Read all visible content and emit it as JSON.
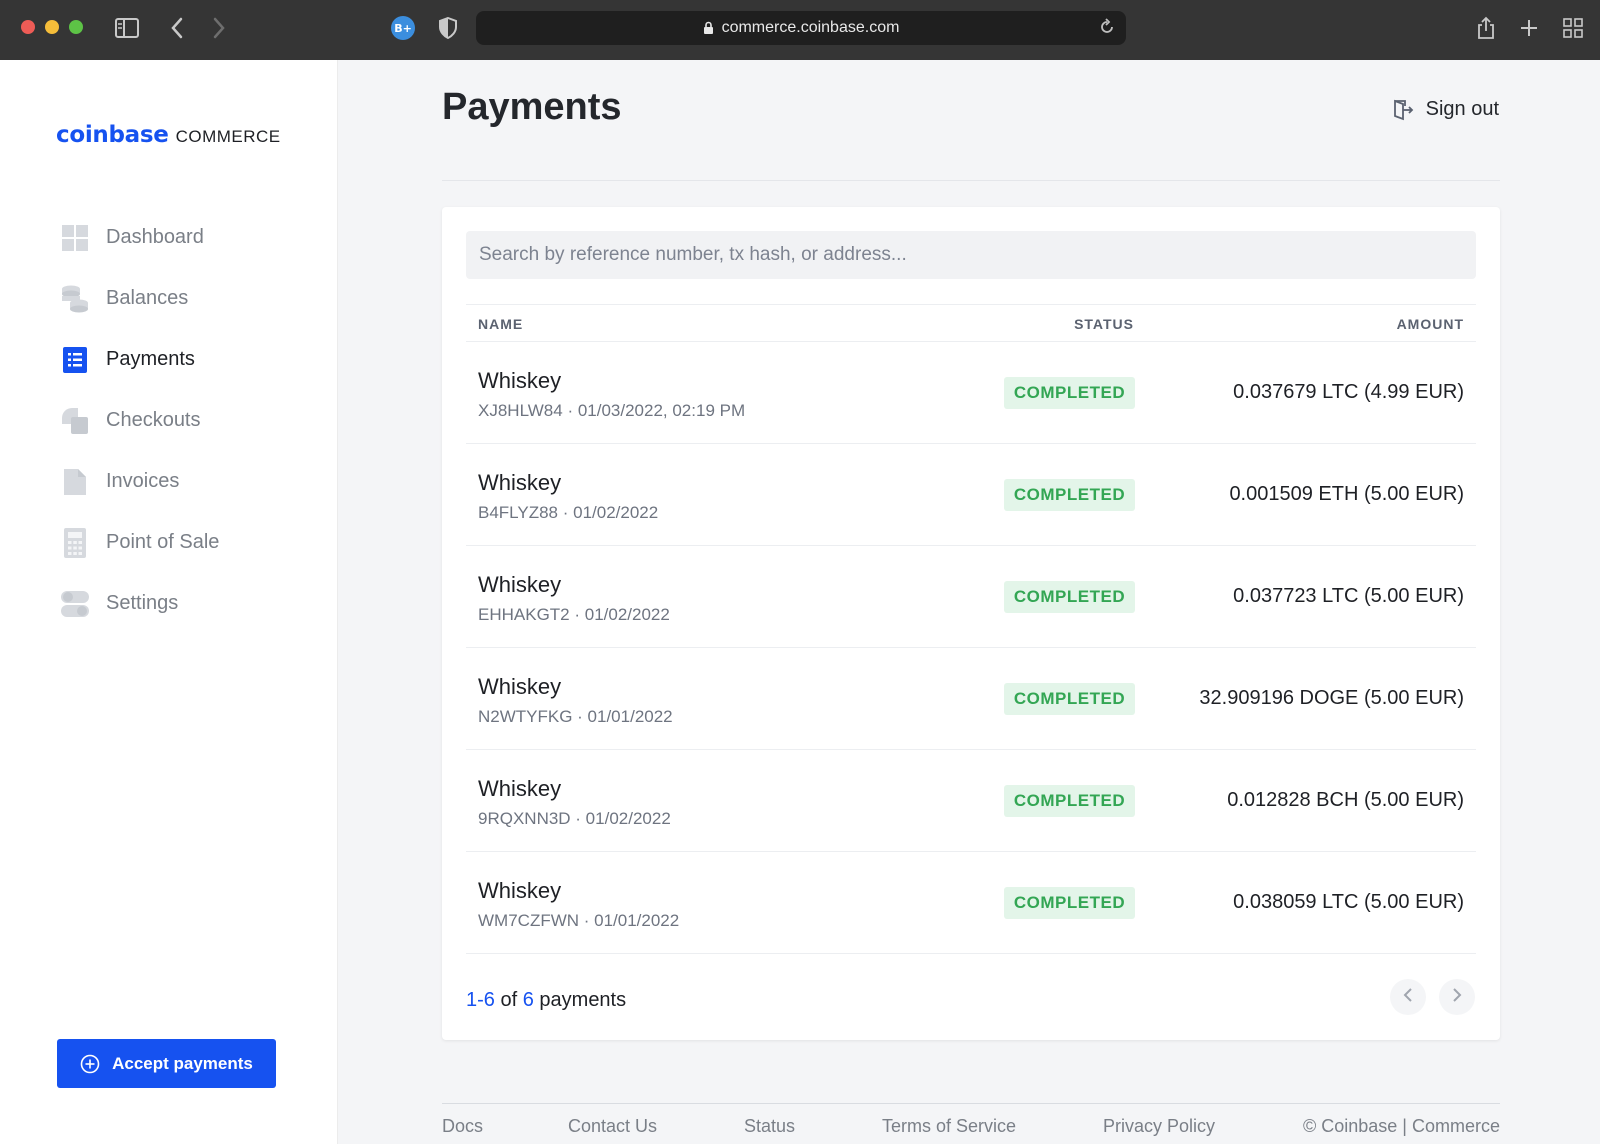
{
  "browser": {
    "url": "commerce.coinbase.com",
    "extension_badge": "B+"
  },
  "brand": {
    "main": "coinbase",
    "sub": "COMMERCE",
    "color": "#1652f0"
  },
  "sidebar": {
    "items": [
      {
        "label": "Dashboard",
        "icon": "grid-icon",
        "active": false
      },
      {
        "label": "Balances",
        "icon": "coins-icon",
        "active": false
      },
      {
        "label": "Payments",
        "icon": "list-document-icon",
        "active": true
      },
      {
        "label": "Checkouts",
        "icon": "copy-icon",
        "active": false
      },
      {
        "label": "Invoices",
        "icon": "file-icon",
        "active": false
      },
      {
        "label": "Point of Sale",
        "icon": "calculator-icon",
        "active": false
      },
      {
        "label": "Settings",
        "icon": "toggle-icon",
        "active": false
      }
    ],
    "accept_button": "Accept payments"
  },
  "header": {
    "title": "Payments",
    "signout": "Sign out"
  },
  "search": {
    "placeholder": "Search by reference number, tx hash, or address..."
  },
  "table": {
    "columns": {
      "name": "NAME",
      "status": "STATUS",
      "amount": "AMOUNT"
    },
    "rows": [
      {
        "name": "Whiskey",
        "sub": "XJ8HLW84 · 01/03/2022, 02:19 PM",
        "status": "COMPLETED",
        "amount": "0.037679 LTC (4.99 EUR)"
      },
      {
        "name": "Whiskey",
        "sub": "B4FLYZ88 · 01/02/2022",
        "status": "COMPLETED",
        "amount": "0.001509 ETH (5.00 EUR)"
      },
      {
        "name": "Whiskey",
        "sub": "EHHAKGT2 · 01/02/2022",
        "status": "COMPLETED",
        "amount": "0.037723 LTC (5.00 EUR)"
      },
      {
        "name": "Whiskey",
        "sub": "N2WTYFKG · 01/01/2022",
        "status": "COMPLETED",
        "amount": "32.909196 DOGE (5.00 EUR)"
      },
      {
        "name": "Whiskey",
        "sub": "9RQXNN3D · 01/02/2022",
        "status": "COMPLETED",
        "amount": "0.012828 BCH (5.00 EUR)"
      },
      {
        "name": "Whiskey",
        "sub": "WM7CZFWN · 01/01/2022",
        "status": "COMPLETED",
        "amount": "0.038059 LTC (5.00 EUR)"
      }
    ],
    "status_colors": {
      "completed_bg": "#e3f5e9",
      "completed_text": "#33a654"
    }
  },
  "pagination": {
    "range": "1-6",
    "of": "of",
    "total": "6",
    "suffix": "payments"
  },
  "footer": {
    "links": [
      "Docs",
      "Contact Us",
      "Status",
      "Terms of Service",
      "Privacy Policy",
      "© Coinbase | Commerce"
    ]
  }
}
